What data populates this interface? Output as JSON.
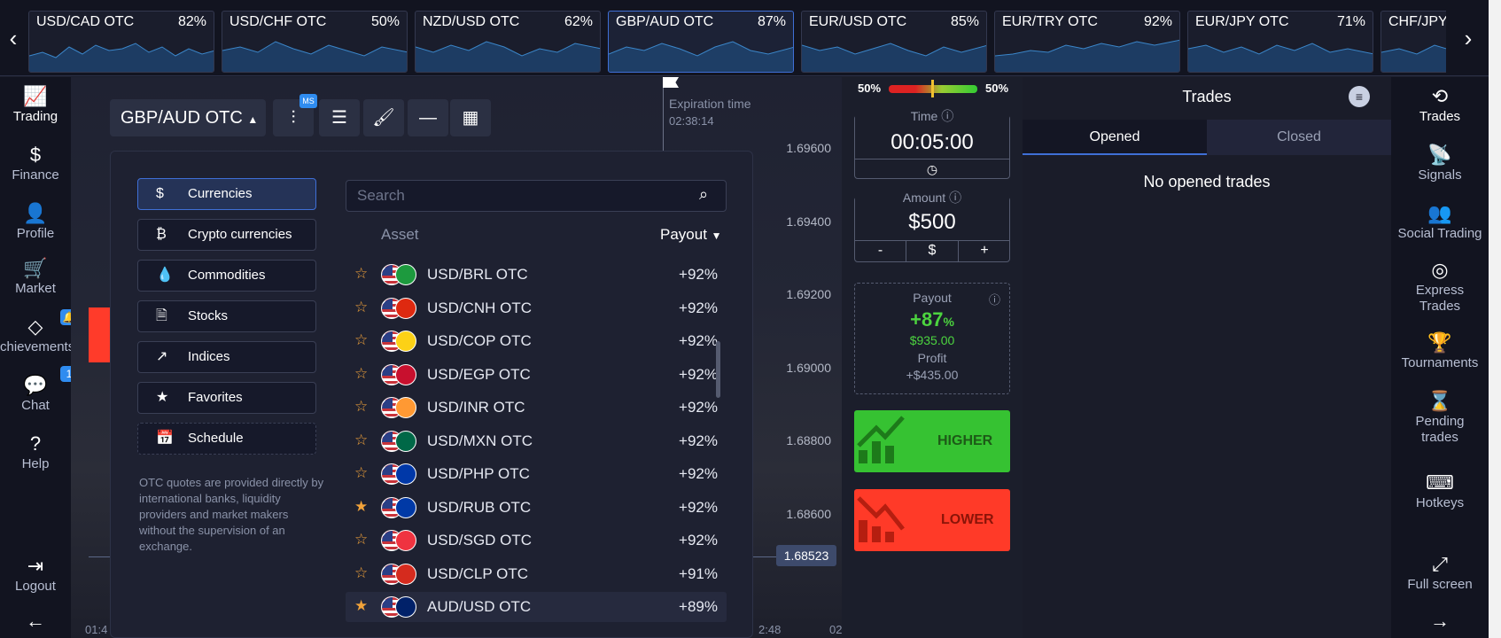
{
  "tickers": [
    {
      "name": "USD/CAD OTC",
      "payout": "82%"
    },
    {
      "name": "USD/CHF OTC",
      "payout": "50%"
    },
    {
      "name": "NZD/USD OTC",
      "payout": "62%"
    },
    {
      "name": "GBP/AUD OTC",
      "payout": "87%"
    },
    {
      "name": "EUR/USD OTC",
      "payout": "85%"
    },
    {
      "name": "EUR/TRY OTC",
      "payout": "92%"
    },
    {
      "name": "EUR/JPY OTC",
      "payout": "71%"
    },
    {
      "name": "CHF/JPY OTC",
      "payout": ""
    }
  ],
  "leftnav": {
    "trading": "Trading",
    "finance": "Finance",
    "profile": "Profile",
    "market": "Market",
    "achievements": "chievements",
    "achievements_badge": "",
    "chat": "Chat",
    "chat_badge": "1",
    "help": "Help",
    "logout": "Logout"
  },
  "toolbar": {
    "asset": "GBP/AUD OTC",
    "ms_badge": "MS"
  },
  "chart": {
    "expiration_label": "Expiration time",
    "expiration_time": "02:38:14",
    "prices": [
      "1.69600",
      "1.69400",
      "1.69200",
      "1.69000",
      "1.68800",
      "1.68600"
    ],
    "current_price": "1.68523",
    "time_left": "01:4",
    "time_mid": "2:48",
    "time_right": "02"
  },
  "panel": {
    "categories": [
      {
        "label": "Currencies"
      },
      {
        "label": "Crypto currencies"
      },
      {
        "label": "Commodities"
      },
      {
        "label": "Stocks"
      },
      {
        "label": "Indices"
      },
      {
        "label": "Favorites"
      },
      {
        "label": "Schedule"
      }
    ],
    "otc_note": "OTC quotes are provided directly by international banks, liquidity providers and market makers without the supervision of an exchange.",
    "search_placeholder": "Search",
    "col_asset": "Asset",
    "col_payout": "Payout",
    "assets": [
      {
        "name": "USD/BRL OTC",
        "payout": "+92%",
        "fav": false,
        "flag2": "#1d9a3e"
      },
      {
        "name": "USD/CNH OTC",
        "payout": "+92%",
        "fav": false,
        "flag2": "#de2910"
      },
      {
        "name": "USD/COP OTC",
        "payout": "+92%",
        "fav": false,
        "flag2": "#fcd116"
      },
      {
        "name": "USD/EGP OTC",
        "payout": "+92%",
        "fav": false,
        "flag2": "#c8102e"
      },
      {
        "name": "USD/INR OTC",
        "payout": "+92%",
        "fav": false,
        "flag2": "#ff9933"
      },
      {
        "name": "USD/MXN OTC",
        "payout": "+92%",
        "fav": false,
        "flag2": "#006847"
      },
      {
        "name": "USD/PHP OTC",
        "payout": "+92%",
        "fav": false,
        "flag2": "#0038a8"
      },
      {
        "name": "USD/RUB OTC",
        "payout": "+92%",
        "fav": true,
        "flag2": "#0039a6"
      },
      {
        "name": "USD/SGD OTC",
        "payout": "+92%",
        "fav": false,
        "flag2": "#ef3340"
      },
      {
        "name": "USD/CLP OTC",
        "payout": "+91%",
        "fav": false,
        "flag2": "#d52b1e"
      },
      {
        "name": "AUD/USD OTC",
        "payout": "+89%",
        "fav": true,
        "flag2": "#012169"
      }
    ]
  },
  "trade": {
    "sentiment_left": "50%",
    "sentiment_right": "50%",
    "time_label": "Time",
    "time_value": "00:05:00",
    "amount_label": "Amount",
    "amount_value": "$500",
    "minus": "-",
    "currency": "$",
    "plus": "+",
    "payout_label": "Payout",
    "payout_pct": "+87",
    "payout_pct_sign": "%",
    "payout_amount": "$935.00",
    "profit_label": "Profit",
    "profit_value": "+$435.00",
    "higher": "HIGHER",
    "lower": "LOWER"
  },
  "trades": {
    "title": "Trades",
    "tab_opened": "Opened",
    "tab_closed": "Closed",
    "empty": "No opened trades"
  },
  "rightnav": {
    "trades": "Trades",
    "signals": "Signals",
    "social": "Social Trading",
    "express_1": "Express",
    "express_2": "Trades",
    "tournaments": "Tournaments",
    "pending_1": "Pending",
    "pending_2": "trades",
    "hotkeys": "Hotkeys",
    "fullscreen": "Full screen"
  },
  "colors": {
    "accent": "#3f6fd6",
    "higher": "#36c232",
    "lower": "#ff3a28",
    "star": "#f2a33a"
  }
}
